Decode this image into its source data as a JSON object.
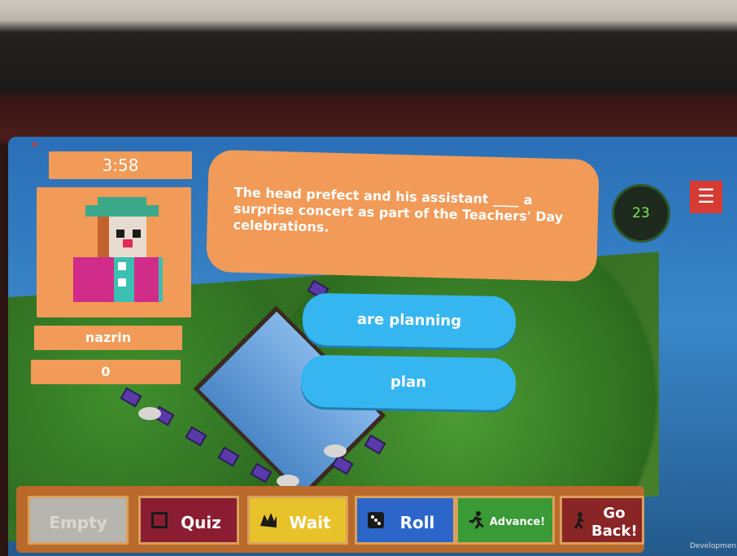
{
  "hud": {
    "timer": "3:58",
    "player_name": "nazrin",
    "score": "0",
    "turn_counter": "23",
    "menu_icon": "hamburger-icon"
  },
  "question": {
    "text": "The head prefect and his assistant ____ a surprise concert as part of the Teachers' Day celebrations."
  },
  "answers": [
    {
      "label": "are planning"
    },
    {
      "label": "plan"
    }
  ],
  "toolbar": {
    "items": [
      {
        "label": "Empty",
        "icon": "empty-slot",
        "color": "#b7b5b0"
      },
      {
        "label": "Quiz",
        "icon": "book-icon",
        "color": "#8a1d32"
      },
      {
        "label": "Wait",
        "icon": "hand-icon",
        "color": "#e8c22a"
      },
      {
        "label": "Roll",
        "icon": "dice-icon",
        "color": "#2d66c9"
      },
      {
        "label": "Advance!",
        "icon": "running-man-icon",
        "color": "#3a9a36"
      },
      {
        "label": "Go Back!",
        "icon": "go-back-icon",
        "color": "#8a2525"
      }
    ]
  },
  "footer": {
    "dev_label": "Developmen"
  },
  "colors": {
    "panel": "#f29a57",
    "answer": "#36b6f0",
    "counter_text": "#7de84d",
    "menu": "#d63b33"
  }
}
